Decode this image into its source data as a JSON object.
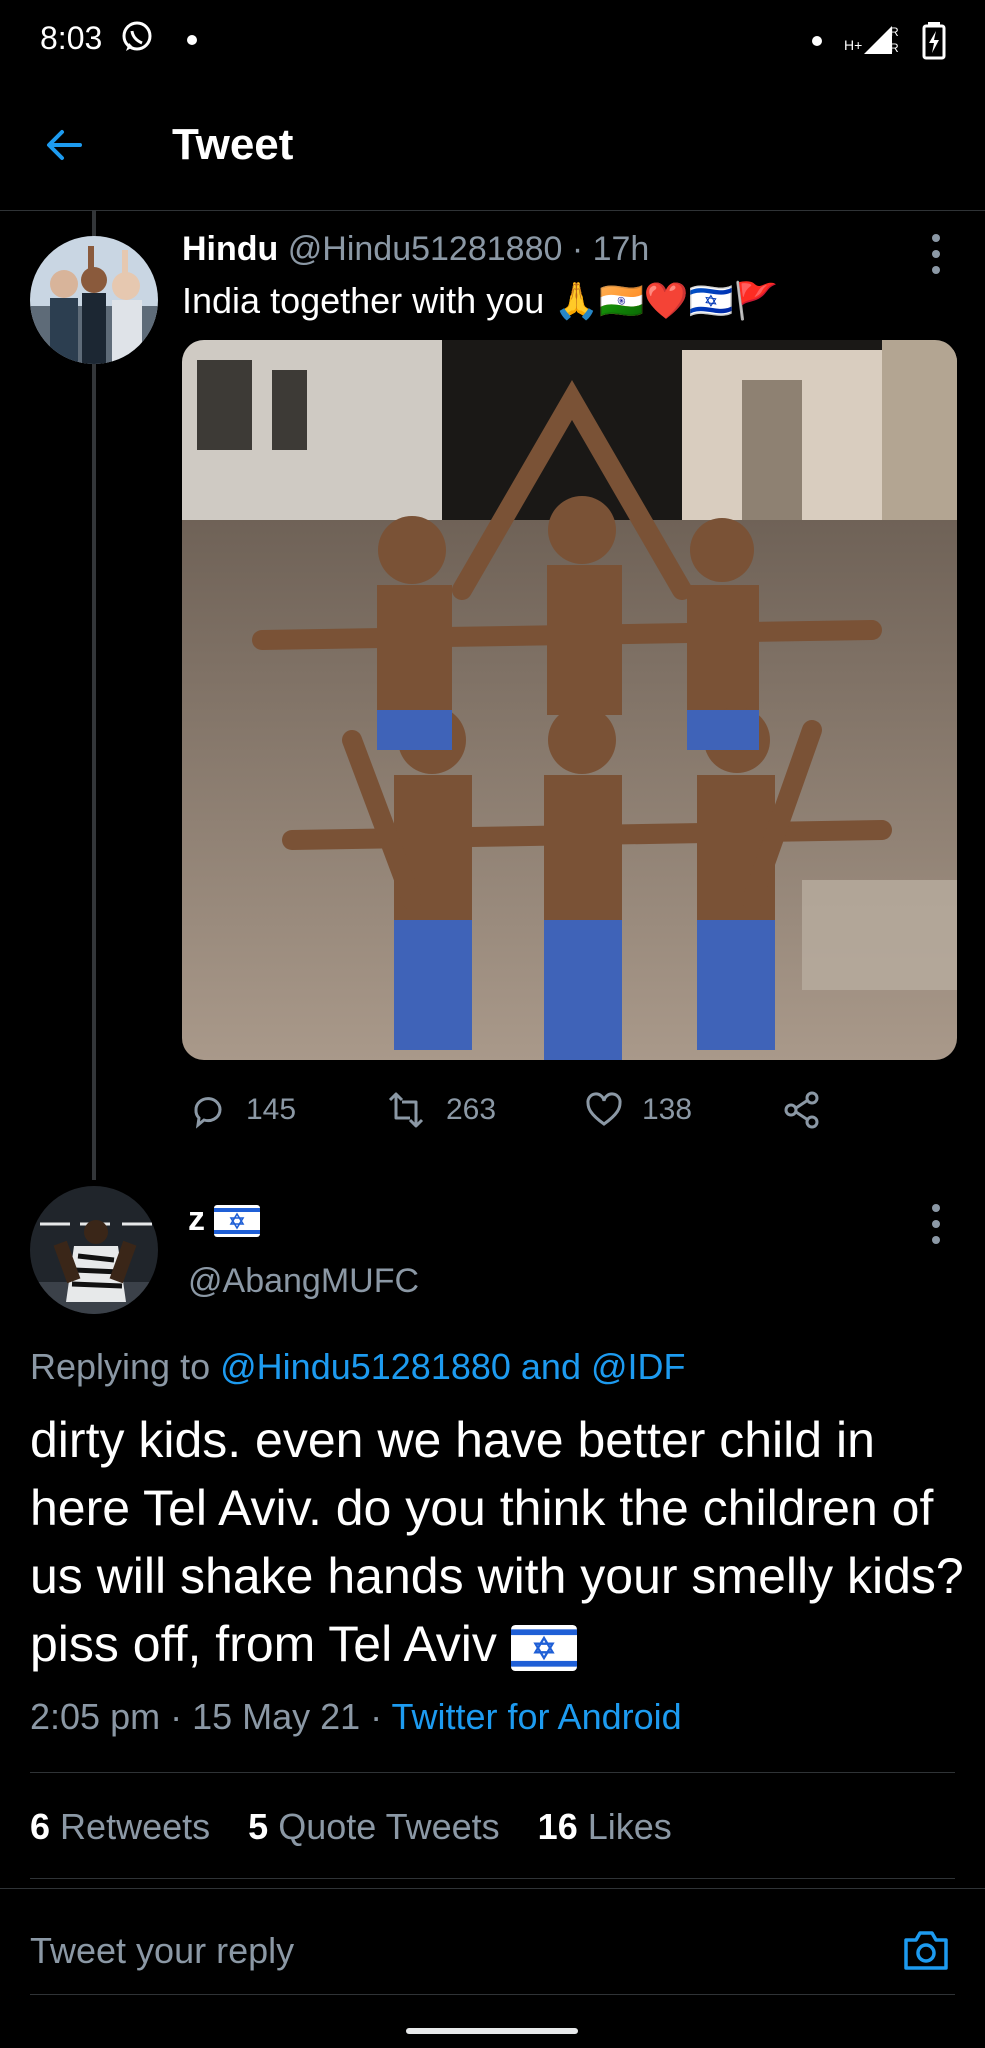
{
  "status_bar": {
    "time": "8:03"
  },
  "header": {
    "title": "Tweet"
  },
  "tweet1": {
    "display_name": "Hindu",
    "handle_time": "@Hindu51281880 · 17h",
    "text": "India together with you",
    "emoji": "🙏🇮🇳❤️🇮🇱🚩",
    "actions": {
      "replies": "145",
      "retweets": "263",
      "likes": "138"
    }
  },
  "tweet2": {
    "display_name": "z",
    "handle": "@AbangMUFC",
    "replying_prefix": "Replying to",
    "replying_users": "@Hindu51281880 and @IDF",
    "text": "dirty kids. even we have better child in here Tel Aviv. do you think the children of us will shake hands with your smelly kids? piss off, from Tel Aviv",
    "time_date": "2:05 pm · 15 May 21 · ",
    "client": "Twitter for Android",
    "stats": {
      "retweets_count": "6",
      "retweets_label": "Retweets",
      "quotes_count": "5",
      "quotes_label": "Quote Tweets",
      "likes_count": "16",
      "likes_label": "Likes"
    }
  },
  "reply_box": {
    "placeholder": "Tweet your reply"
  },
  "colors": {
    "accent": "#1d9bf0",
    "background": "#000000",
    "secondary_text": "#8b98a5",
    "divider": "#2f3336"
  },
  "icons": [
    "back-arrow-icon",
    "reply-icon",
    "retweet-icon",
    "like-icon",
    "share-icon",
    "more-icon",
    "camera-icon",
    "whatsapp-icon",
    "signal-icon",
    "battery-icon"
  ]
}
